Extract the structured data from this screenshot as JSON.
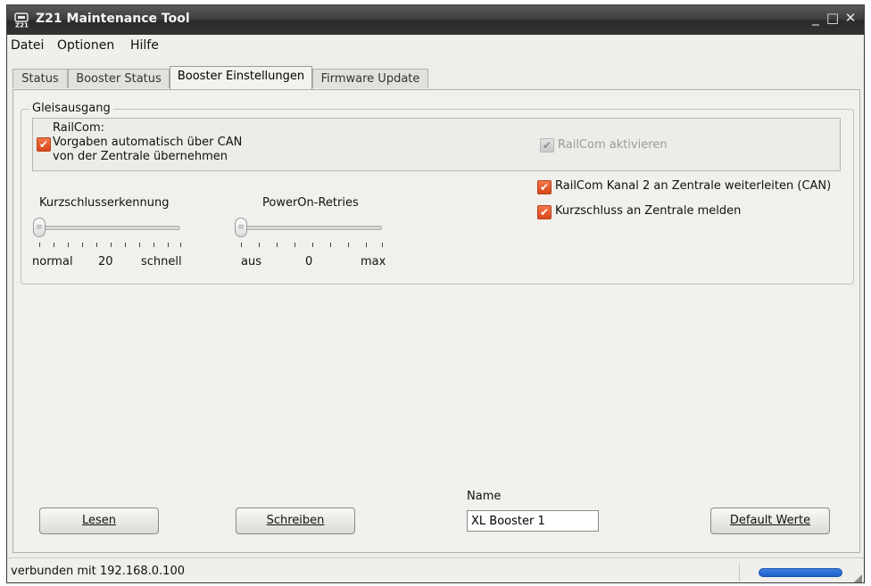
{
  "window": {
    "title": "Z21 Maintenance Tool",
    "minimize_glyph": "_",
    "maximize_glyph": "□",
    "close_glyph": "✕"
  },
  "menu": [
    "Datei",
    "Optionen",
    "Hilfe"
  ],
  "tabs": [
    {
      "label": "Status",
      "active": false
    },
    {
      "label": "Booster Status",
      "active": false
    },
    {
      "label": "Booster Einstellungen",
      "active": true
    },
    {
      "label": "Firmware Update",
      "active": false
    }
  ],
  "group": {
    "title": "Gleisausgang",
    "railcom_heading": "RailCom:",
    "railcom_auto_line1": "Vorgaben automatisch über CAN",
    "railcom_auto_line2": "von der Zentrale übernehmen",
    "railcom_auto_checked": true,
    "railcom_activate_label": "RailCom aktivieren",
    "railcom_activate_checked": true,
    "railcom_activate_enabled": false,
    "railcom_channel2_label": "RailCom Kanal 2 an Zentrale weiterleiten (CAN)",
    "railcom_channel2_checked": true,
    "short_report_label": "Kurzschluss an Zentrale melden",
    "short_report_checked": true
  },
  "sliders": {
    "short_detection": {
      "label": "Kurzschlusserkennung",
      "min_label": "normal",
      "value": "20",
      "max_label": "schnell"
    },
    "poweron_retries": {
      "label": "PowerOn-Retries",
      "min_label": "aus",
      "value": "0",
      "max_label": "max"
    }
  },
  "buttons": {
    "read": "Lesen",
    "write": "Schreiben",
    "defaults": "Default Werte"
  },
  "name_field": {
    "label": "Name",
    "value": "XL Booster 1"
  },
  "status": {
    "text": "verbunden mit 192.168.0.100"
  },
  "icons": {
    "app": "z21-app-icon",
    "check": "checkmark-icon",
    "grip": "resize-grip-icon"
  },
  "colors": {
    "checkbox_accent": "#e4572a",
    "progress": "#2a6dd6",
    "titlebar": "#3c3c3c"
  }
}
